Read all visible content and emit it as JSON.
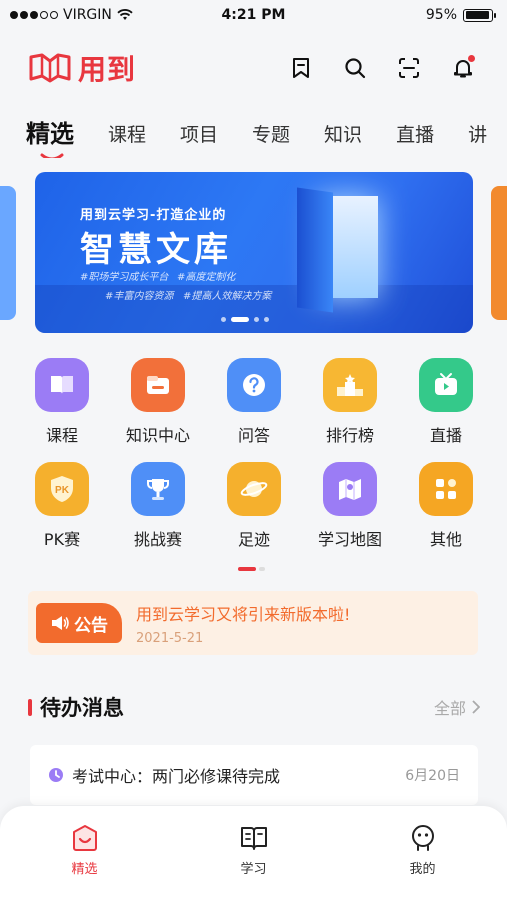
{
  "status_bar": {
    "carrier": "VIRGIN",
    "time": "4:21 PM",
    "battery": "95%",
    "battery_level": 0.95
  },
  "header": {
    "app_name": "用到",
    "brand_color": "#e8373f"
  },
  "tabs": [
    {
      "label": "精选",
      "active": true
    },
    {
      "label": "课程"
    },
    {
      "label": "项目"
    },
    {
      "label": "专题"
    },
    {
      "label": "知识"
    },
    {
      "label": "直播"
    },
    {
      "label": "讲"
    }
  ],
  "banner": {
    "subtitle": "用到云学习-打造企业的",
    "title": "智慧文库",
    "tags": [
      "#职场学习成长平台",
      "#高度定制化",
      "#丰富内容资源",
      "#提高人效解决方案"
    ],
    "slide_count": 4,
    "active_slide": 1
  },
  "grid": [
    {
      "label": "课程",
      "icon": "book-icon",
      "color": "#9b7cf5"
    },
    {
      "label": "知识中心",
      "icon": "folder-icon",
      "color": "#f2703a"
    },
    {
      "label": "问答",
      "icon": "question-icon",
      "color": "#4f8ff7"
    },
    {
      "label": "排行榜",
      "icon": "podium-icon",
      "color": "#f7b733"
    },
    {
      "label": "直播",
      "icon": "tv-icon",
      "color": "#34c98a"
    },
    {
      "label": "PK赛",
      "icon": "pk-shield-icon",
      "color": "#f5b02d"
    },
    {
      "label": "挑战赛",
      "icon": "trophy-icon",
      "color": "#4f8ff7"
    },
    {
      "label": "足迹",
      "icon": "planet-icon",
      "color": "#f5b02d"
    },
    {
      "label": "学习地图",
      "icon": "map-icon",
      "color": "#9b7cf5"
    },
    {
      "label": "其他",
      "icon": "apps-icon",
      "color": "#f5a623"
    }
  ],
  "notice": {
    "badge": "公告",
    "text": "用到云学习又将引来新版本啦!",
    "date": "2021-5-21"
  },
  "todo": {
    "title": "待办消息",
    "all_label": "全部",
    "items": [
      {
        "text": "考试中心：两门必修课待完成",
        "date": "6月20日"
      }
    ]
  },
  "bottom_nav": [
    {
      "label": "精选",
      "active": true
    },
    {
      "label": "学习"
    },
    {
      "label": "我的"
    }
  ]
}
